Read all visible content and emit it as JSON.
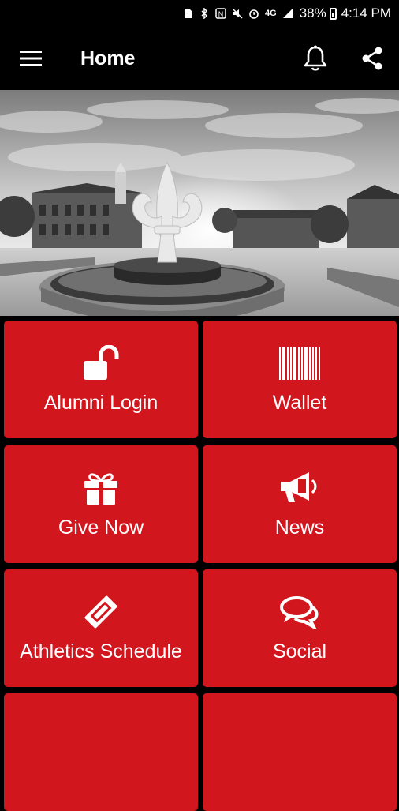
{
  "status_bar": {
    "battery": "38%",
    "time": "4:14 PM",
    "network": "4G"
  },
  "app_bar": {
    "title": "Home"
  },
  "tiles": [
    {
      "label": "Alumni Login",
      "icon": "unlock-icon"
    },
    {
      "label": "Wallet",
      "icon": "barcode-icon"
    },
    {
      "label": "Give Now",
      "icon": "gift-icon"
    },
    {
      "label": "News",
      "icon": "megaphone-icon"
    },
    {
      "label": "Athletics Schedule",
      "icon": "ticket-icon"
    },
    {
      "label": "Social",
      "icon": "chat-bubbles-icon"
    }
  ],
  "colors": {
    "tile_red": "#d2161e",
    "background": "#000000"
  }
}
